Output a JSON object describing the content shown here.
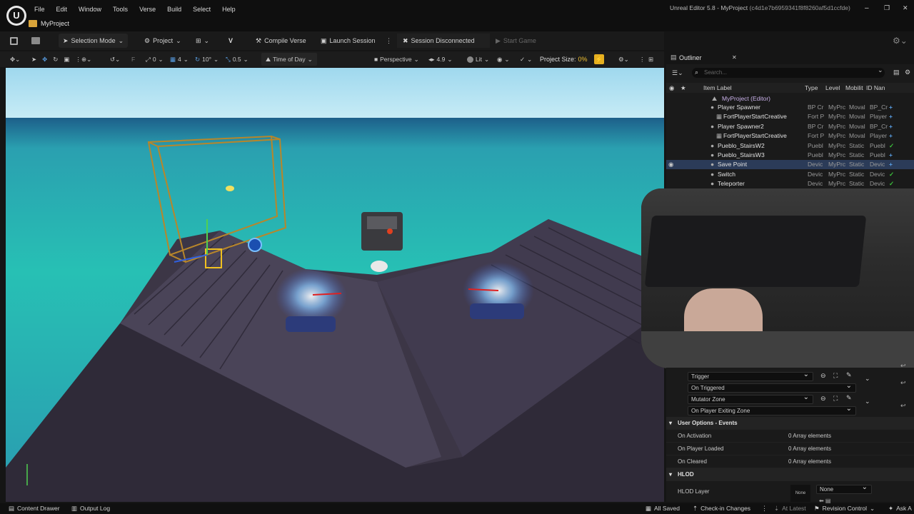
{
  "window": {
    "title": "Unreal Editor 5.8 - MyProject",
    "hash": "(c4d1e7b6959341f8f8260af5d1ccfde)",
    "min": "–",
    "max": "❐",
    "close": "✕"
  },
  "menu": [
    "File",
    "Edit",
    "Window",
    "Tools",
    "Verse",
    "Build",
    "Select",
    "Help"
  ],
  "tab": {
    "label": "MyProject"
  },
  "toolbar": {
    "selection_mode": "Selection Mode",
    "project": "Project",
    "compile_verse": "Compile Verse",
    "launch_session": "Launch Session",
    "session_status": "Session Disconnected",
    "start_game": "Start Game"
  },
  "viewport_toolbar": {
    "snap_rot": "0",
    "snap_grid": "4",
    "snap_angle": "10°",
    "snap_scale": "0.5",
    "time_of_day": "Time of Day",
    "perspective": "Perspective",
    "fov": "4.9",
    "lit": "Lit",
    "project_size_label": "Project Size:",
    "project_size_value": "0%"
  },
  "outliner": {
    "title": "Outliner",
    "close": "✕",
    "search_placeholder": "Search...",
    "columns": {
      "label": "Item Label",
      "type": "Type",
      "level": "Level",
      "mobility": "Mobilit",
      "id": "ID Nan"
    },
    "root": "MyProject (Editor)",
    "rows": [
      {
        "label": "Player Spawner",
        "type": "BP Cr",
        "level": "MyPrc",
        "mobility": "Moval",
        "id": "BP_Cr",
        "status": "plus",
        "indent": 1,
        "selected": false
      },
      {
        "label": "FortPlayerStartCreative",
        "type": "Fort P",
        "level": "MyPrc",
        "mobility": "Moval",
        "id": "Player",
        "status": "plus",
        "indent": 2,
        "selected": false
      },
      {
        "label": "Player Spawner2",
        "type": "BP Cr",
        "level": "MyPrc",
        "mobility": "Moval",
        "id": "BP_Cr",
        "status": "plus",
        "indent": 1,
        "selected": false
      },
      {
        "label": "FortPlayerStartCreative",
        "type": "Fort P",
        "level": "MyPrc",
        "mobility": "Moval",
        "id": "Player",
        "status": "plus",
        "indent": 2,
        "selected": false
      },
      {
        "label": "Pueblo_StairsW2",
        "type": "Puebl",
        "level": "MyPrc",
        "mobility": "Static",
        "id": "Puebl",
        "status": "check",
        "indent": 1,
        "selected": false
      },
      {
        "label": "Pueblo_StairsW3",
        "type": "Puebl",
        "level": "MyPrc",
        "mobility": "Static",
        "id": "Puebl",
        "status": "plus",
        "indent": 1,
        "selected": false
      },
      {
        "label": "Save Point",
        "type": "Devic",
        "level": "MyPrc",
        "mobility": "Static",
        "id": "Devic",
        "status": "plus",
        "indent": 1,
        "selected": true
      },
      {
        "label": "Switch",
        "type": "Devic",
        "level": "MyPrc",
        "mobility": "Static",
        "id": "Devic",
        "status": "check",
        "indent": 1,
        "selected": false
      },
      {
        "label": "Teleporter",
        "type": "Devic",
        "level": "MyPrc",
        "mobility": "Static",
        "id": "Devic",
        "status": "check",
        "indent": 1,
        "selected": false
      }
    ]
  },
  "details": {
    "trigger": "Trigger",
    "on_triggered": "On Triggered",
    "mutator_zone": "Mutator Zone",
    "on_player_exiting_zone": "On Player Exiting Zone",
    "section_events": "User Options - Events",
    "events": [
      {
        "label": "On Activation",
        "value": "0 Array elements"
      },
      {
        "label": "On Player Loaded",
        "value": "0 Array elements"
      },
      {
        "label": "On Cleared",
        "value": "0 Array elements"
      }
    ],
    "section_hlod": "HLOD",
    "hlod_layer_label": "HLOD Layer",
    "hlod_layer_value": "None",
    "hlod_thumb": "None"
  },
  "statusbar": {
    "content_drawer": "Content Drawer",
    "output_log": "Output Log",
    "all_saved": "All Saved",
    "checkin": "Check-in Changes",
    "at_latest": "At Latest",
    "revision_control": "Revision Control",
    "ask": "Ask A"
  },
  "colors": {
    "accent_blue": "#2b3b58",
    "plus": "#5aa0e6",
    "check": "#3cc03c",
    "sea": "#27b8b0",
    "sky": "#a8dcef"
  }
}
